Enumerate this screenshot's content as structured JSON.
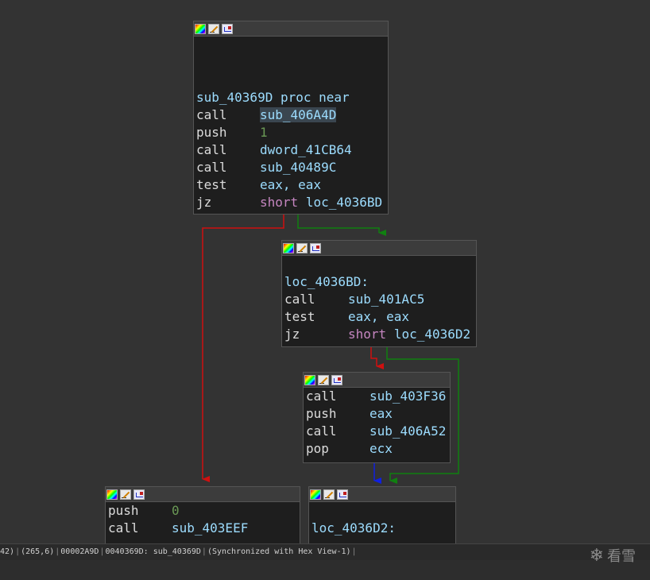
{
  "graph": {
    "edge_colors": {
      "false": "#d01010",
      "true": "#108010",
      "normal": "#1020e0"
    },
    "nodes": [
      {
        "id": "sub_40369D",
        "lines": [
          {
            "kind": "label",
            "text": "sub_40369D proc near"
          },
          {
            "kind": "ins",
            "mnemonic": "call",
            "operands": "sub_406A4D",
            "highlight": true
          },
          {
            "kind": "ins",
            "mnemonic": "push",
            "operands": "1",
            "operand_type": "num"
          },
          {
            "kind": "ins",
            "mnemonic": "call",
            "operands": "dword_41CB64"
          },
          {
            "kind": "ins",
            "mnemonic": "call",
            "operands": "sub_40489C"
          },
          {
            "kind": "ins",
            "mnemonic": "test",
            "operands": "eax, eax"
          },
          {
            "kind": "ins",
            "mnemonic": "jz",
            "keyword": "short",
            "operands": "loc_4036BD"
          }
        ]
      },
      {
        "id": "loc_4036BD",
        "lines": [
          {
            "kind": "label",
            "text": "loc_4036BD:"
          },
          {
            "kind": "ins",
            "mnemonic": "call",
            "operands": "sub_401AC5"
          },
          {
            "kind": "ins",
            "mnemonic": "test",
            "operands": "eax, eax"
          },
          {
            "kind": "ins",
            "mnemonic": "jz",
            "keyword": "short",
            "operands": "loc_4036D2"
          }
        ]
      },
      {
        "id": "block_403F36",
        "lines": [
          {
            "kind": "ins",
            "mnemonic": "call",
            "operands": "sub_403F36"
          },
          {
            "kind": "ins",
            "mnemonic": "push",
            "operands": "eax"
          },
          {
            "kind": "ins",
            "mnemonic": "call",
            "operands": "sub_406A52"
          },
          {
            "kind": "ins",
            "mnemonic": "pop",
            "operands": "ecx"
          }
        ]
      },
      {
        "id": "block_403EEF",
        "lines": [
          {
            "kind": "ins",
            "mnemonic": "push",
            "operands": "0",
            "operand_type": "num"
          },
          {
            "kind": "ins",
            "mnemonic": "call",
            "operands": "sub_403EEF"
          }
        ]
      },
      {
        "id": "loc_4036D2",
        "lines": [
          {
            "kind": "label",
            "text": "loc_4036D2:"
          }
        ]
      }
    ]
  },
  "statusbar": {
    "items": [
      "42)",
      "(265,6)",
      "00002A9D",
      "0040369D: sub_40369D",
      "(Synchronized with Hex View-1)"
    ]
  },
  "watermark": {
    "text": "看雪"
  }
}
